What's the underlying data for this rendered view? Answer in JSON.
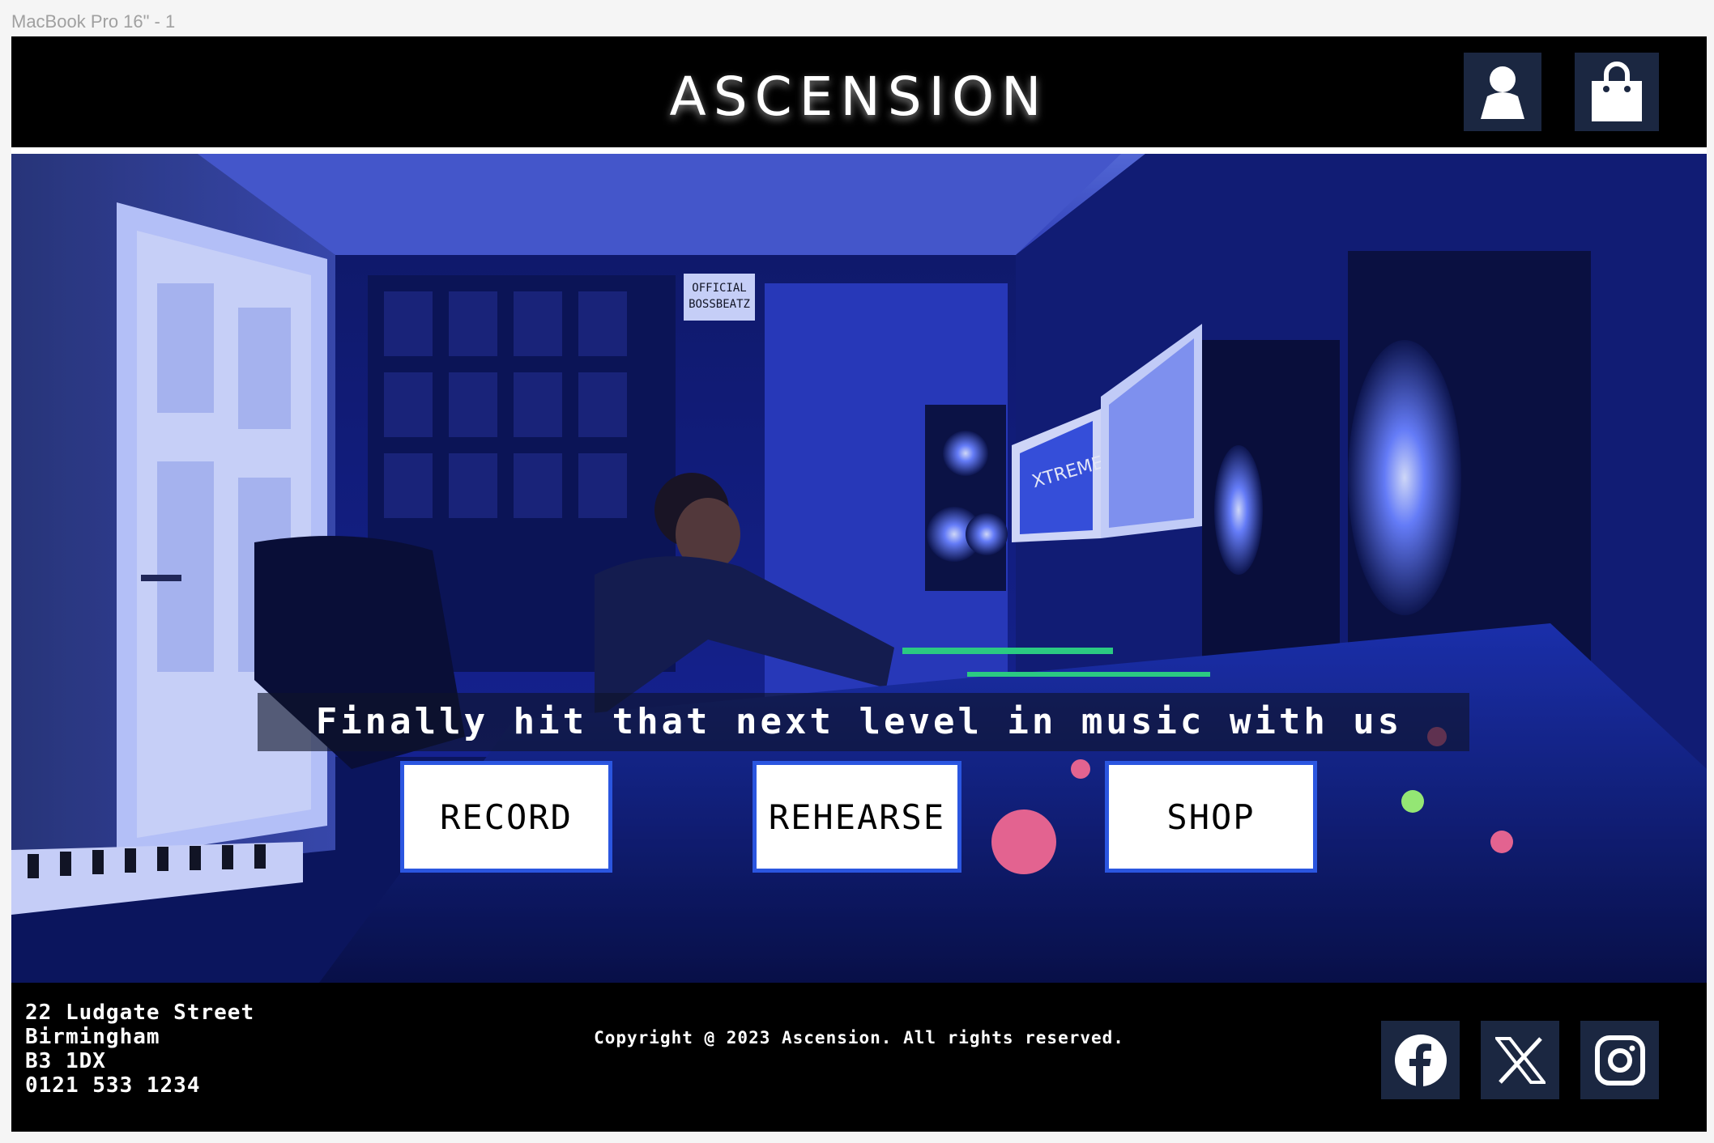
{
  "frame": {
    "label": "MacBook Pro 16\" - 1"
  },
  "header": {
    "brand": "ASCENSION",
    "icons": {
      "account": "user-icon",
      "bag": "shopping-bag-icon"
    }
  },
  "hero": {
    "image": "recording-studio-photo",
    "tagline": "Finally hit that next level in music with us",
    "buttons": {
      "record": "RECORD",
      "rehearse": "REHEARSE",
      "shop": "SHOP"
    },
    "sign": {
      "line1": "OFFICIAL",
      "line2": "BOSSBEATZ"
    },
    "monitor_text": "XTREME"
  },
  "footer": {
    "address": {
      "line1": "22 Ludgate Street",
      "line2": "Birmingham",
      "line3": "B3 1DX",
      "phone": "0121 533 1234"
    },
    "copyright": "Copyright @ 2023 Ascension. All rights reserved.",
    "social": [
      "facebook-icon",
      "x-icon",
      "instagram-icon"
    ]
  },
  "colors": {
    "header_bg": "#000000",
    "icon_tile": "#1b2741",
    "button_border": "#2b56e0",
    "hero_tint": "#1a2fc0"
  }
}
